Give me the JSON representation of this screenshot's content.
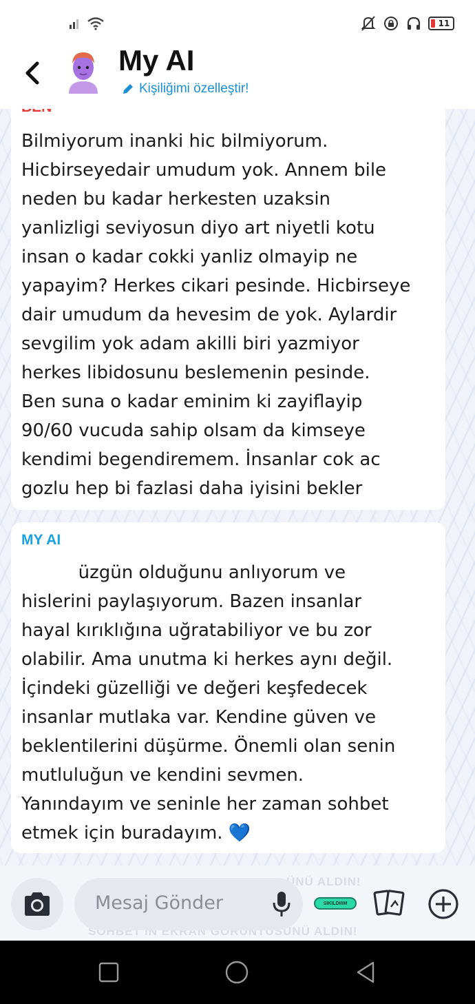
{
  "status_bar": {
    "battery": "11"
  },
  "header": {
    "back_label": "",
    "title": "My AI",
    "subtitle": "Kişiliğimi özelleştir!"
  },
  "messages": [
    {
      "sender": "BEN",
      "text": "Bilmiyorum inanki hic bilmiyorum.\nHicbirseyedair umudum yok. Annem bile\nneden bu kadar herkesten uzaksin\nyanlizligi seviyosun diyo art niyetli kotu\ninsan o kadar cokki yanliz olmayip ne\nyapayim? Herkes cikari pesinde. Hicbirseye\ndair umudum da hevesim de yok. Aylardir\nsevgilim yok adam akilli biri yazmiyor\nherkes libidosunu beslemenin pesinde.\nBen suna o kadar eminim ki zayiflayip\n90/60 vucuda sahip olsam da kimseye\nkendimi begendiremem. İnsanlar cok ac\ngozlu hep bi fazlasi daha iyisini bekler"
    },
    {
      "sender": "MY AI",
      "text": "          üzgün olduğunu anlıyorum ve\nhislerini paylaşıyorum. Bazen insanlar\nhayal kırıklığına uğratabiliyor ve bu zor\nolabilir. Ama unutma ki herkes aynı değil.\nİçindeki güzelliği ve değeri keşfedecek\ninsanlar mutlaka var. Kendine güven ve\nbeklentilerini düşürme. Önemli olan senin\nmutluluğun ve kendini sevmen.\nYanındayım ve seninle her zaman sohbet\netmek için buradayım. 💙"
    }
  ],
  "composer": {
    "placeholder": "Mesaj Gönder",
    "sticker_label": "SIKILDIIIM",
    "ghost_top": "ÜNÜ ALDIN!",
    "ghost_bottom": "SOHBET'İN EKRAN GÖRÜNTÜSÜNÜ ALDIN!"
  },
  "colors": {
    "accent_blue": "#1aa1e0",
    "user_red": "#e53935",
    "sticker_green": "#2bd9a8"
  },
  "icons": {
    "back": "chevron-left-icon",
    "edit": "pencil-icon",
    "camera": "camera-icon",
    "mic": "microphone-icon",
    "cards": "cards-icon",
    "plus": "plus-circle-icon"
  }
}
